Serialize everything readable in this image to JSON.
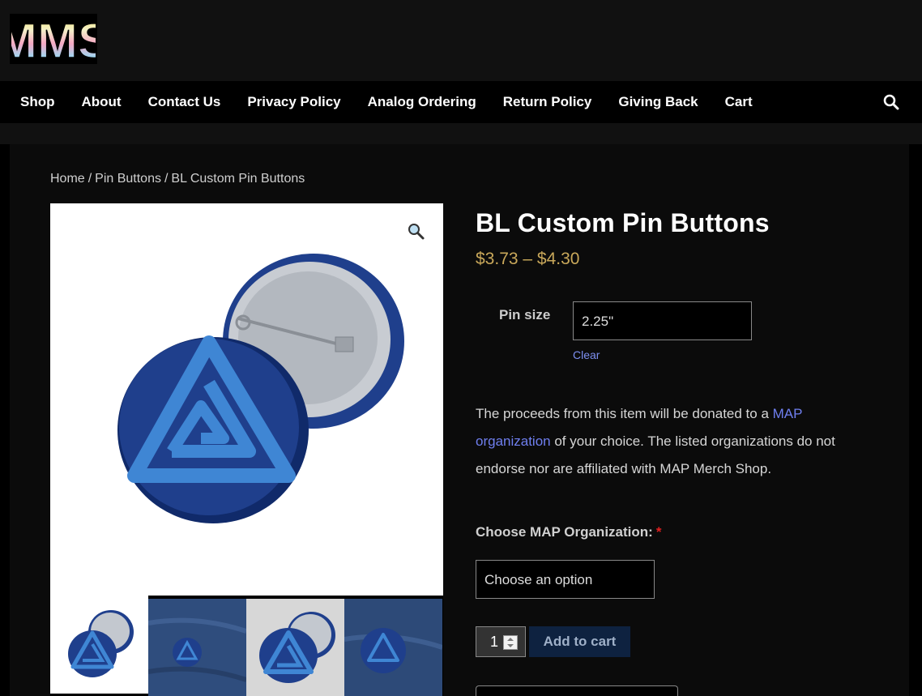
{
  "logo": {
    "text": "MMS"
  },
  "nav": {
    "items": [
      "Shop",
      "About",
      "Contact Us",
      "Privacy Policy",
      "Analog Ordering",
      "Return Policy",
      "Giving Back",
      "Cart"
    ]
  },
  "breadcrumb": {
    "home": "Home",
    "sep": "/",
    "category": "Pin Buttons",
    "current": "BL Custom Pin Buttons"
  },
  "product": {
    "title": "BL Custom Pin Buttons",
    "price_range": "$3.73 – $4.30",
    "variation_label": "Pin size",
    "variation_value": "2.25\"",
    "clear_label": "Clear",
    "desc_before": "The proceeds from this item will be donated to a ",
    "desc_link": "MAP organization",
    "desc_after": " of your choice. The listed organizations do not endorse nor are affiliated with MAP Merch Shop.",
    "choose_label": "Choose MAP Organization:",
    "required_mark": "*",
    "choose_placeholder": "Choose an option",
    "quantity": "1",
    "add_to_cart": "Add to cart"
  },
  "colors": {
    "price": "#c9a85a",
    "link": "#6f7fef",
    "pin_dark": "#1f3f8c",
    "pin_light": "#3f86d4"
  },
  "icons": [
    "search-icon",
    "zoom-icon"
  ]
}
